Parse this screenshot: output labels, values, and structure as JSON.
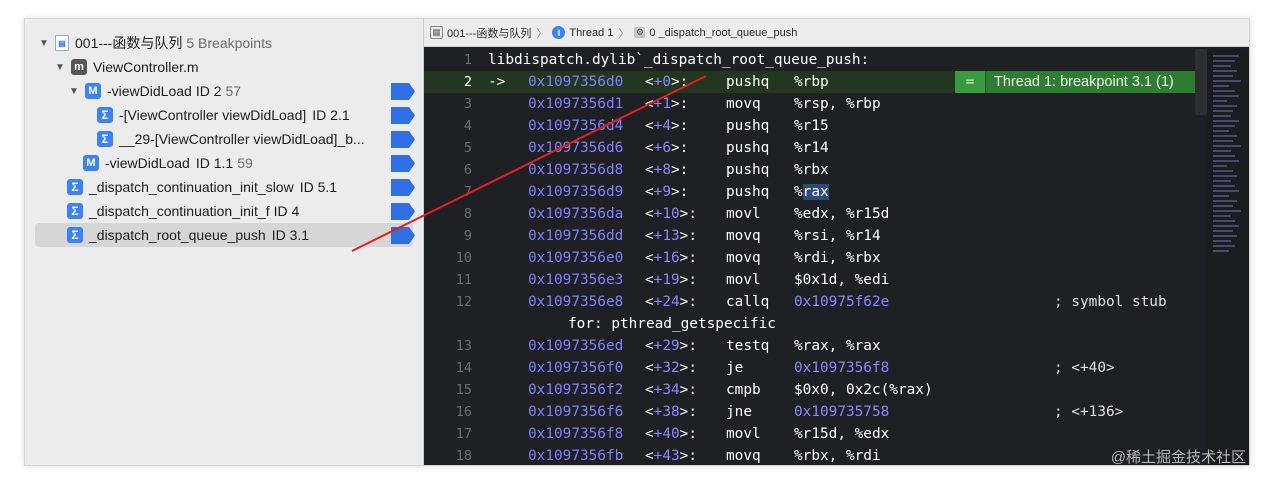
{
  "navigator": {
    "project": {
      "label": "001---函数与队列",
      "sub": "5 Breakpoints"
    },
    "file": {
      "label": "ViewController.m"
    },
    "method1": {
      "label": "-viewDidLoad",
      "id": "ID 2",
      "count": "57"
    },
    "child1": {
      "label": "-[ViewController viewDidLoad]",
      "id": "ID 2.1"
    },
    "child2": {
      "label": "__29-[ViewController viewDidLoad]_b..."
    },
    "method2": {
      "label": "-viewDidLoad",
      "id": "ID 1.1",
      "count": "59"
    },
    "sym1": {
      "label": "_dispatch_continuation_init_slow",
      "id": "ID 5.1"
    },
    "sym2": {
      "label": "_dispatch_continuation_init_f",
      "id": "ID 4"
    },
    "sym3": {
      "label": "_dispatch_root_queue_push",
      "id": "ID 3.1"
    }
  },
  "jumpbar": {
    "project": "001---函数与队列",
    "thread": "Thread 1",
    "frame": "0 _dispatch_root_queue_push"
  },
  "breakpoint_annotation": {
    "symbol": "=",
    "text": "Thread 1: breakpoint 3.1 (1)"
  },
  "code": {
    "header": "libdispatch.dylib`_dispatch_root_queue_push:",
    "arrow": "->",
    "continuation": "for: pthread_getspecific",
    "lines": [
      {
        "n": "1"
      },
      {
        "n": "2",
        "addr": "0x1097356d0",
        "off": "+0",
        "op": "pushq",
        "args": "%rbp"
      },
      {
        "n": "3",
        "addr": "0x1097356d1",
        "off": "+1",
        "op": "movq",
        "args": "%rsp, %rbp"
      },
      {
        "n": "4",
        "addr": "0x1097356d4",
        "off": "+4",
        "op": "pushq",
        "args": "%r15"
      },
      {
        "n": "5",
        "addr": "0x1097356d6",
        "off": "+6",
        "op": "pushq",
        "args": "%r14"
      },
      {
        "n": "6",
        "addr": "0x1097356d8",
        "off": "+8",
        "op": "pushq",
        "args": "%rbx"
      },
      {
        "n": "7",
        "addr": "0x1097356d9",
        "off": "+9",
        "op": "pushq",
        "args": "%rax"
      },
      {
        "n": "8",
        "addr": "0x1097356da",
        "off": "+10",
        "op": "movl",
        "args": "%edx, %r15d"
      },
      {
        "n": "9",
        "addr": "0x1097356dd",
        "off": "+13",
        "op": "movq",
        "args": "%rsi, %r14"
      },
      {
        "n": "10",
        "addr": "0x1097356e0",
        "off": "+16",
        "op": "movq",
        "args": "%rdi, %rbx"
      },
      {
        "n": "11",
        "addr": "0x1097356e3",
        "off": "+19",
        "op": "movl",
        "args": "$0x1d, %edi"
      },
      {
        "n": "12",
        "addr": "0x1097356e8",
        "off": "+24",
        "op": "callq",
        "args": "0x10975f62e",
        "comment": "; symbol stub"
      },
      {
        "n": "13",
        "addr": "0x1097356ed",
        "off": "+29",
        "op": "testq",
        "args": "%rax, %rax"
      },
      {
        "n": "14",
        "addr": "0x1097356f0",
        "off": "+32",
        "op": "je",
        "args": "0x1097356f8",
        "comment": "; <+40>"
      },
      {
        "n": "15",
        "addr": "0x1097356f2",
        "off": "+34",
        "op": "cmpb",
        "args": "$0x0, 0x2c(%rax)"
      },
      {
        "n": "16",
        "addr": "0x1097356f6",
        "off": "+38",
        "op": "jne",
        "args": "0x109735758",
        "comment": "; <+136>"
      },
      {
        "n": "17",
        "addr": "0x1097356f8",
        "off": "+40",
        "op": "movl",
        "args": "%r15d, %edx"
      },
      {
        "n": "18",
        "addr": "0x1097356fb",
        "off": "+43",
        "op": "movq",
        "args": "%rbx, %rdi"
      }
    ]
  },
  "watermark": "@稀土掘金技术社区",
  "colors": {
    "breakpoint": "#2f6fe4",
    "current_line": "#23361f",
    "annotation": "#2e7d32",
    "red_arrow": "#e02020"
  }
}
